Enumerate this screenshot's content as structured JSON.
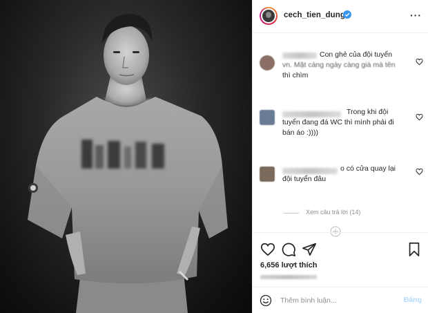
{
  "post": {
    "username": "cech_tien_dung",
    "verified": true,
    "more_label": "···"
  },
  "comments": [
    {
      "lines": [
        "Con ghẻ của đội tuyển",
        "vn. Mặt càng ngày càng già mà tên",
        "thì chìm"
      ],
      "avatar_color": "#8b6f66"
    },
    {
      "lines": [
        "Trong khi đội",
        "tuyển đang đá WC thì mình phải đi",
        "bán áo :))))"
      ],
      "avatar_color": "#6a7b95"
    },
    {
      "lines": [
        "o có cửa quay lại",
        "đội tuyển đâu"
      ],
      "avatar_color": "#7a6a5c"
    }
  ],
  "view_replies": "Xem câu trả lời (14)",
  "actions": {
    "likes": "6,656 lượt thích"
  },
  "add_comment": {
    "placeholder": "Thêm bình luận...",
    "post_label": "Đăng"
  },
  "colors": {
    "verified_blue": "#3897f0",
    "post_disabled": "#b3dbff",
    "meta_gray": "#8e8e8e"
  },
  "icons": [
    "verified-badge-icon",
    "heart-icon",
    "comment-icon",
    "share-icon",
    "bookmark-icon",
    "emoji-icon",
    "loading-spinner-icon"
  ]
}
